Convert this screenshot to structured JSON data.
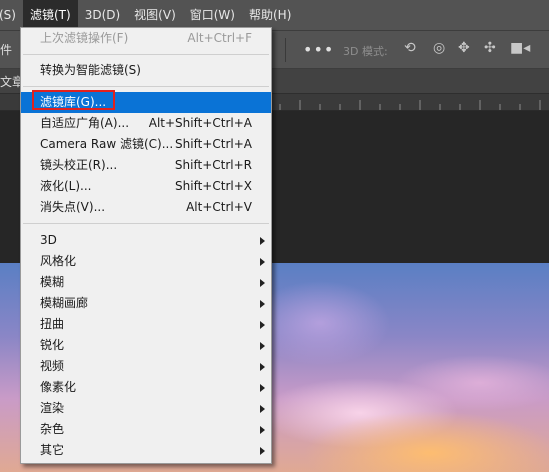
{
  "menubar": {
    "items": [
      {
        "label": "(S)"
      },
      {
        "label": "滤镜(T)"
      },
      {
        "label": "3D(D)"
      },
      {
        "label": "视图(V)"
      },
      {
        "label": "窗口(W)"
      },
      {
        "label": "帮助(H)"
      }
    ]
  },
  "options_bar": {
    "left_label": "件",
    "dots": "•••",
    "mode_3d_label": "3D 模式:"
  },
  "doc_tab": {
    "left_label": "文章"
  },
  "filter_menu": {
    "last_filter": {
      "label": "上次滤镜操作(F)",
      "shortcut": "Alt+Ctrl+F"
    },
    "convert_smart": {
      "label": "转换为智能滤镜(S)"
    },
    "filter_gallery": {
      "label": "滤镜库(G)..."
    },
    "adaptive_wide_angle": {
      "label": "自适应广角(A)...",
      "shortcut": "Alt+Shift+Ctrl+A"
    },
    "camera_raw": {
      "label": "Camera Raw 滤镜(C)...",
      "shortcut": "Shift+Ctrl+A"
    },
    "lens_correction": {
      "label": "镜头校正(R)...",
      "shortcut": "Shift+Ctrl+R"
    },
    "liquify": {
      "label": "液化(L)...",
      "shortcut": "Shift+Ctrl+X"
    },
    "vanishing_point": {
      "label": "消失点(V)...",
      "shortcut": "Alt+Ctrl+V"
    },
    "submenus": [
      {
        "label": "3D"
      },
      {
        "label": "风格化"
      },
      {
        "label": "模糊"
      },
      {
        "label": "模糊画廊"
      },
      {
        "label": "扭曲"
      },
      {
        "label": "锐化"
      },
      {
        "label": "视频"
      },
      {
        "label": "像素化"
      },
      {
        "label": "渲染"
      },
      {
        "label": "杂色"
      },
      {
        "label": "其它"
      }
    ]
  },
  "colors": {
    "highlight": "#0a73d6",
    "annotation_box": "#e0211e",
    "menu_background": "#f0f0f0",
    "app_background": "#535353"
  }
}
